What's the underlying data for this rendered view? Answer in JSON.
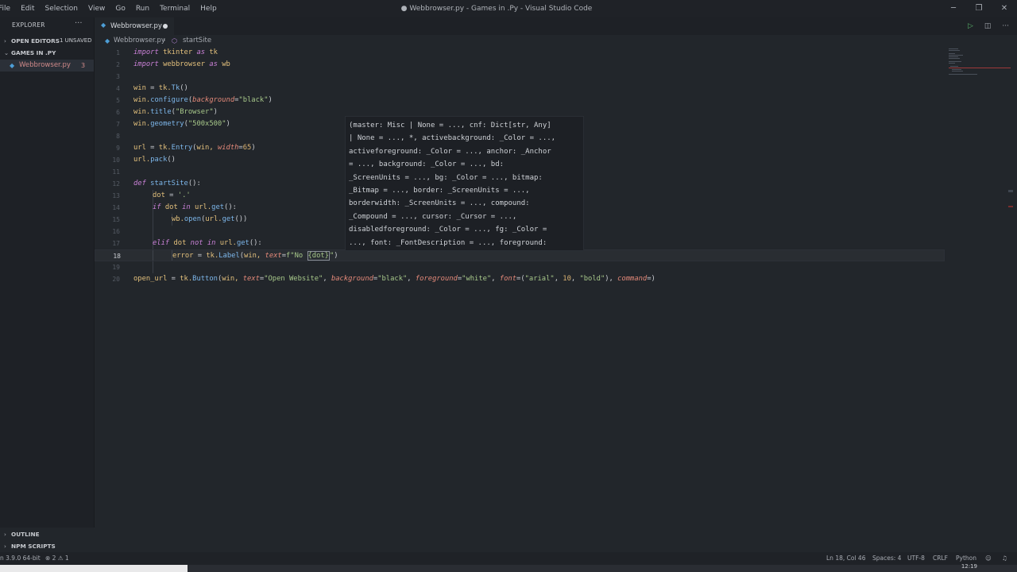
{
  "menu": [
    "File",
    "Edit",
    "Selection",
    "View",
    "Go",
    "Run",
    "Terminal",
    "Help"
  ],
  "window_title": "● Webbrowser.py - Games in .Py - Visual Studio Code",
  "window_controls": {
    "minimize": "─",
    "restore": "❐",
    "close": "✕"
  },
  "explorer": {
    "header": "EXPLORER",
    "more": "···",
    "open_editors": "OPEN EDITORS",
    "unsaved": "1 UNSAVED",
    "folder": "GAMES IN .PY",
    "file_name": "Webbrowser.py",
    "file_problems": "3",
    "outline": "OUTLINE",
    "npm_scripts": "NPM SCRIPTS"
  },
  "tab": {
    "label": "Webbrowser.py"
  },
  "breadcrumb": {
    "file": "Webbrowser.py",
    "separator": "›",
    "symbol": "startSite"
  },
  "line_numbers": [
    "1",
    "2",
    "3",
    "4",
    "5",
    "6",
    "7",
    "8",
    "9",
    "10",
    "11",
    "12",
    "13",
    "14",
    "15",
    "16",
    "17",
    "18",
    "19",
    "20"
  ],
  "code": {
    "l1_kw": "import",
    "l1_mod": " tkinter ",
    "l1_as": "as",
    "l1_alias": " tk",
    "l2_kw": "import",
    "l2_mod": " webbrowser ",
    "l2_as": "as",
    "l2_alias": " wb",
    "l4_var": "win",
    "l4_eq": " = ",
    "l4_mod": "tk.",
    "l4_fn": "Tk",
    "l4_paren": "()",
    "l5_var": "win.",
    "l5_fn": "configure",
    "l5_open": "(",
    "l5_param": "background",
    "l5_eq": "=",
    "l5_str": "\"black\"",
    "l5_close": ")",
    "l6_var": "win.",
    "l6_fn": "title",
    "l6_open": "(",
    "l6_str": "\"Browser\"",
    "l6_close": ")",
    "l7_var": "win.",
    "l7_fn": "geometry",
    "l7_open": "(",
    "l7_str": "\"500x500\"",
    "l7_close": ")",
    "l9_var": "url",
    "l9_eq": " = ",
    "l9_mod": "tk.",
    "l9_fn": "Entry",
    "l9_open": "(",
    "l9_arg": "win, ",
    "l9_param": "width",
    "l9_eq2": "=",
    "l9_num": "65",
    "l9_close": ")",
    "l10_var": "url.",
    "l10_fn": "pack",
    "l10_paren": "()",
    "l12_kw": "def",
    "l12_fn": " startSite",
    "l12_rest": "():",
    "l13_var": "dot",
    "l13_eq": " = ",
    "l13_str": "'.'",
    "l14_kw": "if",
    "l14_mid": " dot ",
    "l14_in": "in",
    "l14_obj": " url.",
    "l14_fn": "get",
    "l14_rest": "():",
    "l15_mod": "wb.",
    "l15_fn": "open",
    "l15_open": "(",
    "l15_obj": "url.",
    "l15_fn2": "get",
    "l15_close": "())",
    "l17_kw": "elif",
    "l17_mid": " dot ",
    "l17_not": "not in",
    "l17_obj": " url.",
    "l17_fn": "get",
    "l17_rest": "():",
    "l18_var": "error",
    "l18_eq": " = ",
    "l18_mod": "tk.",
    "l18_fn": "Label",
    "l18_open": "(",
    "l18_arg": "win, ",
    "l18_param": "text",
    "l18_eq2": "=",
    "l18_str": "f\"No ",
    "l18_brk": "{dot}",
    "l18_str2": "\"",
    "l18_close": ")",
    "l20_var": "open_url",
    "l20_eq": " = ",
    "l20_mod": "tk.",
    "l20_fn": "Button",
    "l20_open": "(",
    "l20_arg": "win, ",
    "l20_p1": "text",
    "l20_s1": "\"Open Website\"",
    "l20_p2": "background",
    "l20_s2": "\"black\"",
    "l20_p3": "foreground",
    "l20_s3": "\"white\"",
    "l20_p4": "font",
    "l20_font_open": "(",
    "l20_s4": "\"arial\"",
    "l20_n1": "10",
    "l20_s5": "\"bold\"",
    "l20_font_close": ")",
    "l20_p5": "command",
    "l20_end": "=)"
  },
  "hover_lines": [
    "(master: Misc | None = ..., cnf: Dict[str, Any]",
    "| None = ..., *, activebackground: _Color = ...,",
    "activeforeground: _Color = ..., anchor: _Anchor",
    "= ..., background: _Color = ..., bd:",
    "_ScreenUnits = ..., bg: _Color = ..., bitmap:",
    "_Bitmap = ..., border: _ScreenUnits = ...,",
    "borderwidth: _ScreenUnits = ..., compound:",
    "_Compound = ..., cursor: _Cursor = ...,",
    "disabledforeground: _Color = ..., fg: _Color =",
    "..., font: _FontDescription = ..., foreground:"
  ],
  "status": {
    "interpreter": "n 3.9.0 64-bit",
    "problems": "⊗ 2 ⚠ 1",
    "position": "Ln 18, Col 46",
    "spaces": "Spaces: 4",
    "encoding": "UTF-8",
    "eol": "CRLF",
    "language": "Python"
  },
  "taskbar": {
    "clock": "12:19"
  },
  "colors": {
    "keyword": "#c980d6",
    "function": "#7db7eb",
    "string": "#a7c88a",
    "param": "#e68a7a",
    "accent": "#4d9ed6"
  }
}
